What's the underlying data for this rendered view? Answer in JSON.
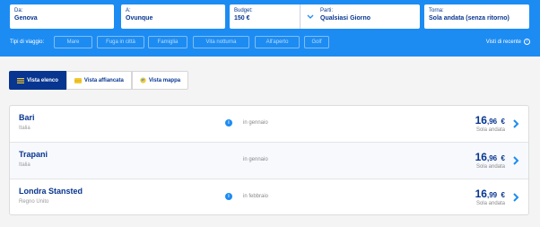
{
  "search": {
    "from": {
      "label": "Da:",
      "value": "Genova"
    },
    "to": {
      "label": "A:",
      "value": "Ovunque"
    },
    "budget": {
      "label": "Budget:",
      "value": "150 €"
    },
    "leave": {
      "label": "Parti:",
      "value": "Qualsiasi Giorno"
    },
    "return": {
      "label": "Torna:",
      "value": "Sola andata (senza ritorno)"
    }
  },
  "trip_types": {
    "label": "Tipi di viaggio:",
    "options": [
      "Mare",
      "Fuga in città",
      "Famiglia",
      "Vita notturna",
      "All'aperto",
      "Golf"
    ]
  },
  "recent": {
    "label": "Visti di recente",
    "icon": "clock-icon"
  },
  "views": [
    {
      "label": "Vista elenco",
      "icon": "list-icon",
      "active": true
    },
    {
      "label": "Vista affiancata",
      "icon": "tiles-icon",
      "active": false
    },
    {
      "label": "Vista mappa",
      "icon": "globe-icon",
      "active": false
    }
  ],
  "results": [
    {
      "destination": "Bari",
      "country": "Italia",
      "month": "in gennaio",
      "price_int": "16",
      "price_dec": ",96",
      "currency": "€",
      "fare": "Sola andata",
      "info": true
    },
    {
      "destination": "Trapani",
      "country": "Italia",
      "month": "in gennaio",
      "price_int": "16",
      "price_dec": ",96",
      "currency": "€",
      "fare": "Sola andata",
      "info": false
    },
    {
      "destination": "Londra Stansted",
      "country": "Regno Unito",
      "month": "in febbraio",
      "price_int": "16",
      "price_dec": ",99",
      "currency": "€",
      "fare": "Sola andata",
      "info": true
    }
  ],
  "colors": {
    "primary": "#1d8cf2",
    "navy": "#073590",
    "accent_yellow": "#f1c933"
  }
}
